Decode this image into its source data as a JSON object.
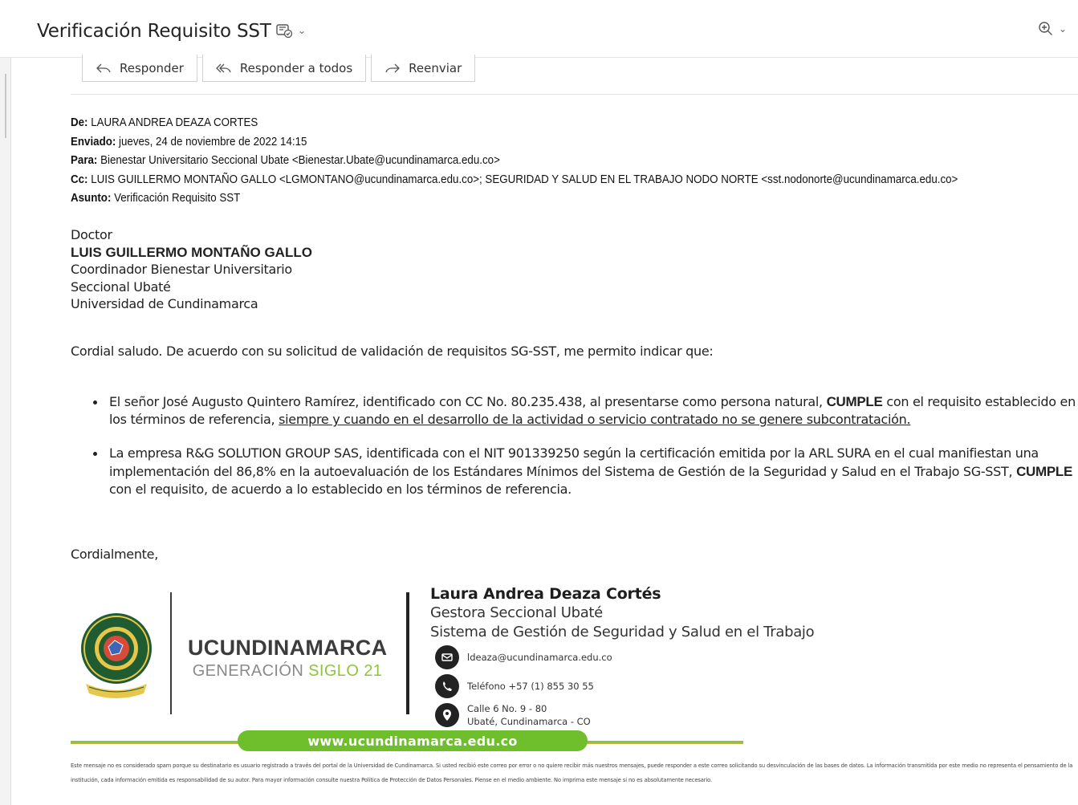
{
  "header": {
    "subject": "Verificación Requisito SST",
    "subject_icon": "tag-check-icon",
    "zoom_icon": "zoom-in-icon"
  },
  "actions": {
    "reply": "Responder",
    "reply_all": "Responder a todos",
    "forward": "Reenviar"
  },
  "message_header": {
    "from_label": "De:",
    "from": "LAURA ANDREA DEAZA CORTES",
    "sent_label": "Enviado:",
    "sent": "jueves, 24 de noviembre de 2022 14:15",
    "to_label": "Para:",
    "to": "Bienestar Universitario Seccional Ubate <Bienestar.Ubate@ucundinamarca.edu.co>",
    "cc_label": "Cc:",
    "cc": "LUIS GUILLERMO MONTAÑO GALLO <LGMONTANO@ucundinamarca.edu.co>; SEGURIDAD Y SALUD EN EL TRABAJO NODO NORTE <sst.nodonorte@ucundinamarca.edu.co>",
    "subject_label": "Asunto:",
    "subject": "Verificación Requisito SST"
  },
  "body": {
    "salutation_title": "Doctor",
    "recipient_name": "LUIS GUILLERMO MONTAÑO GALLO",
    "recipient_role": "Coordinador Bienestar Universitario",
    "recipient_unit": "Seccional Ubaté",
    "recipient_org": "Universidad de Cundinamarca",
    "greeting": "Cordial saludo. De acuerdo con su solicitud de validación de requisitos SG-SST, me permito indicar que:",
    "bullet1_a": "El señor José Augusto Quintero Ramírez, identificado con CC No. 80.235.438, al presentarse como persona natural, ",
    "bullet1_strong": "CUMPLE",
    "bullet1_b": " con el requisito establecido en los términos de referencia, ",
    "bullet1_underline": "siempre y cuando en el desarrollo de la actividad o servicio contratado no se genere subcontratación.",
    "bullet2_a": "La empresa R&G SOLUTION GROUP SAS, identificada con el NIT 901339250 según la certificación emitida por la ARL SURA en el cual manifiestan una implementación del 86,8% en la autoevaluación de los Estándares Mínimos del Sistema de Gestión de la Seguridad y Salud en el Trabajo SG-SST, ",
    "bullet2_strong": "CUMPLE",
    "bullet2_b": " con el requisito, de acuerdo a lo establecido en los términos de referencia.",
    "closing": "Cordialmente,"
  },
  "signature": {
    "name": "Laura Andrea Deaza Cortés",
    "role": "Gestora Seccional Ubaté",
    "department": "Sistema de Gestión de Seguridad y Salud en el Trabajo",
    "email": "ldeaza@ucundinamarca.edu.co",
    "phone": "Teléfono +57 (1) 855 30 55",
    "address_line1": "Calle 6 No. 9 - 80",
    "address_line2": "Ubaté, Cundinamarca - CO",
    "brand_name": "UCUNDINAMARCA",
    "brand_sub_a": "GENERACIÓN ",
    "brand_sub_b": "SIGLO 21",
    "website": "www.ucundinamarca.edu.co",
    "brand_green": "#6fbf2c"
  },
  "disclaimer": "Este mensaje no es considerado spam porque su destinatario es usuario registrado a través del portal de la Universidad de Cundinamarca. Si usted recibió este correo por error o no quiere recibir más nuestros mensajes, puede responder a este correo solicitando su desvinculación de las bases de datos. La información transmitida por este medio no representa el pensamiento de la institución, cada información emitida es responsabilidad de su autor. Para mayor información consulte nuestra Política de Protección de Datos Personales. Piense en el medio ambiente. No imprima este mensaje si no es absolutamente necesario."
}
